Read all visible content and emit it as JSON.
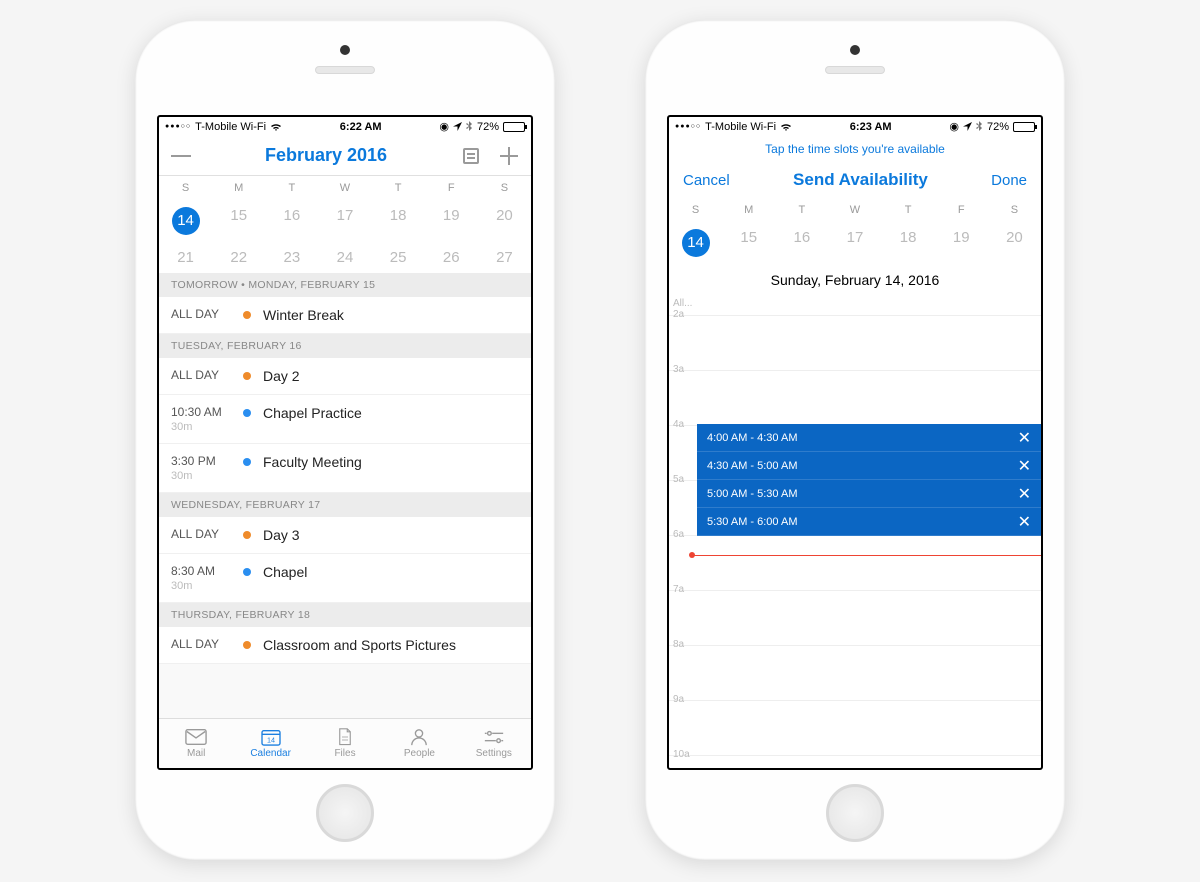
{
  "phone1": {
    "status": {
      "carrier": "T-Mobile Wi-Fi",
      "time": "6:22 AM",
      "battery": "72%"
    },
    "nav": {
      "title": "February 2016"
    },
    "dow": [
      "S",
      "M",
      "T",
      "W",
      "T",
      "F",
      "S"
    ],
    "week1": [
      "14",
      "15",
      "16",
      "17",
      "18",
      "19",
      "20"
    ],
    "week2": [
      "21",
      "22",
      "23",
      "24",
      "25",
      "26",
      "27"
    ],
    "today": "14",
    "sections": [
      {
        "header": "TOMORROW • MONDAY, FEBRUARY 15",
        "events": [
          {
            "time": "ALL DAY",
            "dur": "",
            "dot": "orange",
            "title": "Winter Break"
          }
        ]
      },
      {
        "header": "TUESDAY, FEBRUARY 16",
        "events": [
          {
            "time": "ALL DAY",
            "dur": "",
            "dot": "orange",
            "title": "Day 2"
          },
          {
            "time": "10:30 AM",
            "dur": "30m",
            "dot": "blue",
            "title": "Chapel Practice"
          },
          {
            "time": "3:30 PM",
            "dur": "30m",
            "dot": "blue",
            "title": "Faculty Meeting"
          }
        ]
      },
      {
        "header": "WEDNESDAY, FEBRUARY 17",
        "events": [
          {
            "time": "ALL DAY",
            "dur": "",
            "dot": "orange",
            "title": "Day 3"
          },
          {
            "time": "8:30 AM",
            "dur": "30m",
            "dot": "blue",
            "title": "Chapel"
          }
        ]
      },
      {
        "header": "THURSDAY, FEBRUARY 18",
        "events": [
          {
            "time": "ALL DAY",
            "dur": "",
            "dot": "orange",
            "title": "Classroom and Sports Pictures"
          }
        ]
      }
    ],
    "tabs": [
      {
        "label": "Mail",
        "active": false
      },
      {
        "label": "Calendar",
        "active": true
      },
      {
        "label": "Files",
        "active": false
      },
      {
        "label": "People",
        "active": false
      },
      {
        "label": "Settings",
        "active": false
      }
    ]
  },
  "phone2": {
    "status": {
      "carrier": "T-Mobile Wi-Fi",
      "time": "6:23 AM",
      "battery": "72%"
    },
    "hint": "Tap the time slots you're available",
    "nav": {
      "cancel": "Cancel",
      "title": "Send Availability",
      "done": "Done"
    },
    "dow": [
      "S",
      "M",
      "T",
      "W",
      "T",
      "F",
      "S"
    ],
    "week": [
      "14",
      "15",
      "16",
      "17",
      "18",
      "19",
      "20"
    ],
    "today": "14",
    "full_date": "Sunday, February 14, 2016",
    "all_label": "All...",
    "hours": [
      "2a",
      "3a",
      "4a",
      "5a",
      "6a",
      "7a",
      "8a",
      "9a",
      "10a"
    ],
    "slots": [
      {
        "label": "4:00 AM - 4:30 AM"
      },
      {
        "label": "4:30 AM - 5:00 AM"
      },
      {
        "label": "5:00 AM - 5:30 AM"
      },
      {
        "label": "5:30 AM - 6:00 AM"
      }
    ],
    "slots_start_hour_idx": 2,
    "now_hour_idx": 4,
    "now_fraction": 0.38
  }
}
